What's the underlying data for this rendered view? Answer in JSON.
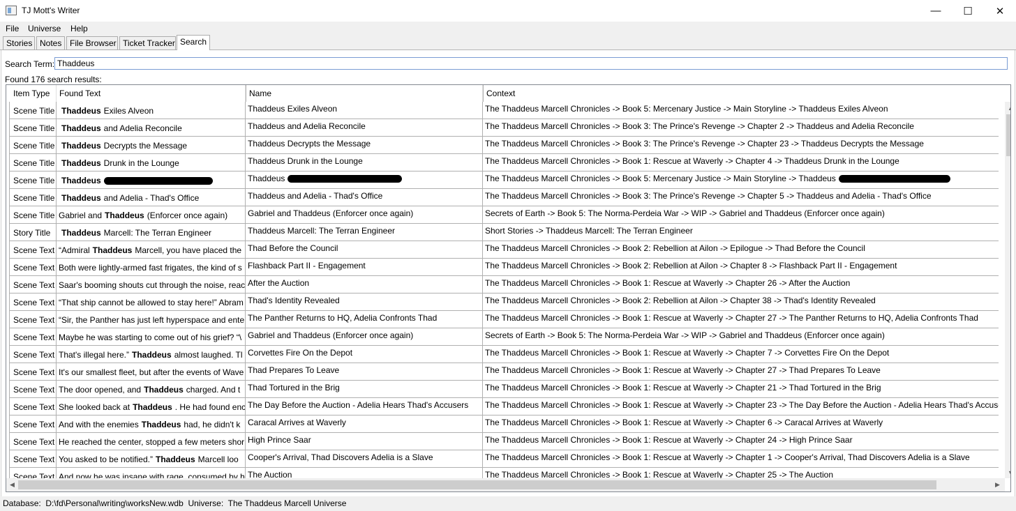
{
  "window": {
    "title": "TJ Mott's Writer",
    "minimize": "—",
    "maximize": "☐",
    "close": "✕"
  },
  "menu": [
    "File",
    "Universe",
    "Help"
  ],
  "tabs": [
    "Stories",
    "Notes",
    "File Browser",
    "Ticket Tracker",
    "Search"
  ],
  "search": {
    "label": "Search Term:",
    "value": "Thaddeus",
    "found": "Found 176 search results:"
  },
  "columns": [
    "Item Type",
    "Found Text",
    "Name",
    "Context"
  ],
  "rows": [
    {
      "type": "Scene Title",
      "pre": "",
      "bold": "Thaddeus",
      "post": "Exiles Alveon",
      "name": "Thaddeus Exiles Alveon",
      "context": "The Thaddeus Marcell Chronicles -> Book 5: Mercenary Justice -> Main Storyline -> Thaddeus Exiles Alveon"
    },
    {
      "type": "Scene Title",
      "pre": "",
      "bold": "Thaddeus",
      "post": "and Adelia Reconcile",
      "name": "Thaddeus and Adelia Reconcile",
      "context": "The Thaddeus Marcell Chronicles -> Book 3: The Prince's Revenge -> Chapter 2 -> Thaddeus and Adelia Reconcile"
    },
    {
      "type": "Scene Title",
      "pre": "",
      "bold": "Thaddeus",
      "post": "Decrypts the Message",
      "name": "Thaddeus Decrypts the Message",
      "context": "The Thaddeus Marcell Chronicles -> Book 3: The Prince's Revenge -> Chapter 23 -> Thaddeus Decrypts the Message"
    },
    {
      "type": "Scene Title",
      "pre": "",
      "bold": "Thaddeus",
      "post": "Drunk in the Lounge",
      "name": "Thaddeus Drunk in the Lounge",
      "context": "The Thaddeus Marcell Chronicles -> Book 1: Rescue at Waverly -> Chapter 4 -> Thaddeus Drunk in the Lounge"
    },
    {
      "type": "Scene Title",
      "pre": "",
      "bold": "Thaddeus",
      "post": "",
      "name": "Thaddeus",
      "context": "The Thaddeus Marcell Chronicles -> Book 5: Mercenary Justice -> Main Storyline -> Thaddeus",
      "redacted": true
    },
    {
      "type": "Scene Title",
      "pre": "",
      "bold": "Thaddeus",
      "post": "and Adelia - Thad's Office",
      "name": "Thaddeus and Adelia - Thad's Office",
      "context": "The Thaddeus Marcell Chronicles -> Book 3: The Prince's Revenge -> Chapter 5 -> Thaddeus and Adelia - Thad's Office"
    },
    {
      "type": "Scene Title",
      "pre": "Gabriel and",
      "bold": "Thaddeus",
      "post": "(Enforcer once again)",
      "name": "Gabriel and Thaddeus (Enforcer once again)",
      "context": "Secrets of Earth -> Book 5: The Norma-Perdeia War -> WIP -> Gabriel and Thaddeus (Enforcer once again)"
    },
    {
      "type": "Story Title",
      "pre": "",
      "bold": "Thaddeus",
      "post": "Marcell: The Terran Engineer",
      "name": "Thaddeus Marcell: The Terran Engineer",
      "context": "Short Stories -> Thaddeus Marcell: The Terran Engineer"
    },
    {
      "type": "Scene Text",
      "pre": "“Admiral",
      "bold": "Thaddeus",
      "post": "Marcell, you have placed the",
      "name": "Thad Before the Council",
      "context": "The Thaddeus Marcell Chronicles -> Book 2: Rebellion at Ailon -> Epilogue -> Thad Before the Council"
    },
    {
      "type": "Scene Text",
      "pre": "Both were lightly-armed fast frigates, the kind of s",
      "bold": "",
      "post": "",
      "name": "Flashback Part II - Engagement",
      "context": "The Thaddeus Marcell Chronicles -> Book 2: Rebellion at Ailon -> Chapter 8 -> Flashback Part II - Engagement"
    },
    {
      "type": "Scene Text",
      "pre": "Saar's booming shouts cut through the noise, reac",
      "bold": "",
      "post": "",
      "name": "After the Auction",
      "context": "The Thaddeus Marcell Chronicles -> Book 1: Rescue at Waverly -> Chapter 26 -> After the Auction"
    },
    {
      "type": "Scene Text",
      "pre": "“That ship cannot be allowed to stay here!” Abram",
      "bold": "",
      "post": "",
      "name": "Thad's Identity Revealed",
      "context": "The Thaddeus Marcell Chronicles -> Book 2: Rebellion at Ailon -> Chapter 38 -> Thad's Identity Revealed"
    },
    {
      "type": "Scene Text",
      "pre": "“Sir, the Panther has just left hyperspace and ente",
      "bold": "",
      "post": "",
      "name": "The Panther Returns to HQ, Adelia Confronts Thad",
      "context": "The Thaddeus Marcell Chronicles -> Book 1: Rescue at Waverly -> Chapter 27 -> The Panther Returns to HQ, Adelia Confronts Thad"
    },
    {
      "type": "Scene Text",
      "pre": "Maybe he was starting to come out of his grief? “\\",
      "bold": "",
      "post": "",
      "name": "Gabriel and Thaddeus (Enforcer once again)",
      "context": "Secrets of Earth -> Book 5: The Norma-Perdeia War -> WIP -> Gabriel and Thaddeus (Enforcer once again)"
    },
    {
      "type": "Scene Text",
      "pre": "That's illegal here.”",
      "bold": "Thaddeus",
      "post": "almost laughed. Tl",
      "name": "Corvettes Fire On the Depot",
      "context": "The Thaddeus Marcell Chronicles -> Book 1: Rescue at Waverly -> Chapter 7 -> Corvettes Fire On the Depot"
    },
    {
      "type": "Scene Text",
      "pre": "It's our smallest fleet, but after the events of Wave",
      "bold": "",
      "post": "",
      "name": "Thad Prepares To Leave",
      "context": "The Thaddeus Marcell Chronicles -> Book 1: Rescue at Waverly -> Chapter 27 -> Thad Prepares To Leave"
    },
    {
      "type": "Scene Text",
      "pre": "The door opened, and",
      "bold": "Thaddeus",
      "post": "charged. And t",
      "name": "Thad Tortured in the Brig",
      "context": "The Thaddeus Marcell Chronicles -> Book 1: Rescue at Waverly -> Chapter 21 -> Thad Tortured in the Brig"
    },
    {
      "type": "Scene Text",
      "pre": "She looked back at",
      "bold": "Thaddeus",
      "post": ". He had found enc",
      "name": "The Day Before the Auction - Adelia Hears Thad's Accusers",
      "context": "The Thaddeus Marcell Chronicles -> Book 1: Rescue at Waverly -> Chapter 23 -> The Day Before the Auction - Adelia Hears Thad's Accusers"
    },
    {
      "type": "Scene Text",
      "pre": "And with the enemies",
      "bold": "Thaddeus",
      "post": "had, he didn't k",
      "name": "Caracal Arrives at Waverly",
      "context": "The Thaddeus Marcell Chronicles -> Book 1: Rescue at Waverly -> Chapter 6 -> Caracal Arrives at Waverly"
    },
    {
      "type": "Scene Text",
      "pre": "He reached the center, stopped a few meters shor",
      "bold": "",
      "post": "",
      "name": "High Prince Saar",
      "context": "The Thaddeus Marcell Chronicles -> Book 1: Rescue at Waverly -> Chapter 24 -> High Prince Saar"
    },
    {
      "type": "Scene Text",
      "pre": "You asked to be notified.”",
      "bold": "Thaddeus",
      "post": "Marcell loo",
      "name": "Cooper's Arrival, Thad Discovers Adelia is a Slave",
      "context": "The Thaddeus Marcell Chronicles -> Book 1: Rescue at Waverly -> Chapter 1 -> Cooper's Arrival, Thad Discovers Adelia is a Slave"
    },
    {
      "type": "Scene Text",
      "pre": "And now he was insane with rage, consumed by h",
      "bold": "",
      "post": "",
      "name": "The Auction",
      "context": "The Thaddeus Marcell Chronicles -> Book 1: Rescue at Waverly -> Chapter 25 -> The Auction"
    }
  ],
  "status": {
    "db_label": "Database:",
    "db_path": "D:\\fd\\Personal\\writing\\worksNew.wdb",
    "universe_label": "Universe:",
    "universe": "The Thaddeus Marcell Universe"
  }
}
